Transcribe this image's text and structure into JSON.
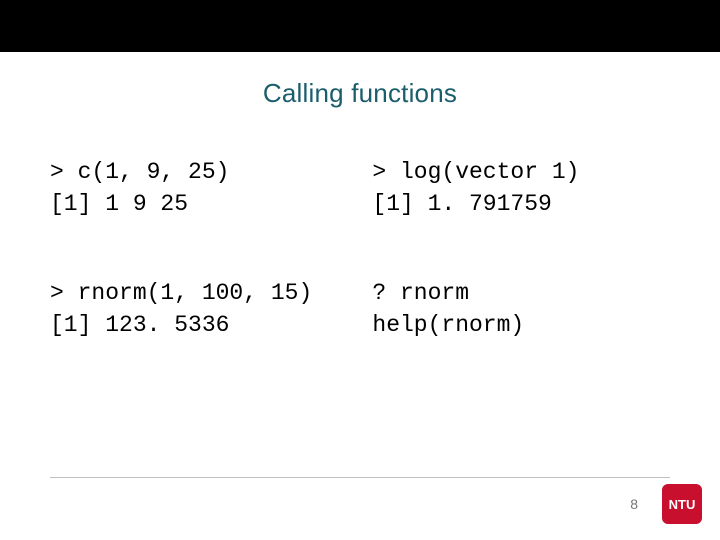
{
  "title": "Calling functions",
  "blocks": {
    "topLeft": {
      "line1": "> c(1, 9, 25)",
      "line2": "[1] 1 9 25"
    },
    "topRight": {
      "line1": "> log(vector 1)",
      "line2": "[1] 1. 791759"
    },
    "bottomLeft": {
      "line1": "> rnorm(1, 100, 15)",
      "line2": "[1] 123. 5336"
    },
    "bottomRight": {
      "line1": "? rnorm",
      "line2": "help(rnorm)"
    }
  },
  "pageNumber": "8",
  "logo": {
    "text": "NTU",
    "color": "#c8102e"
  }
}
